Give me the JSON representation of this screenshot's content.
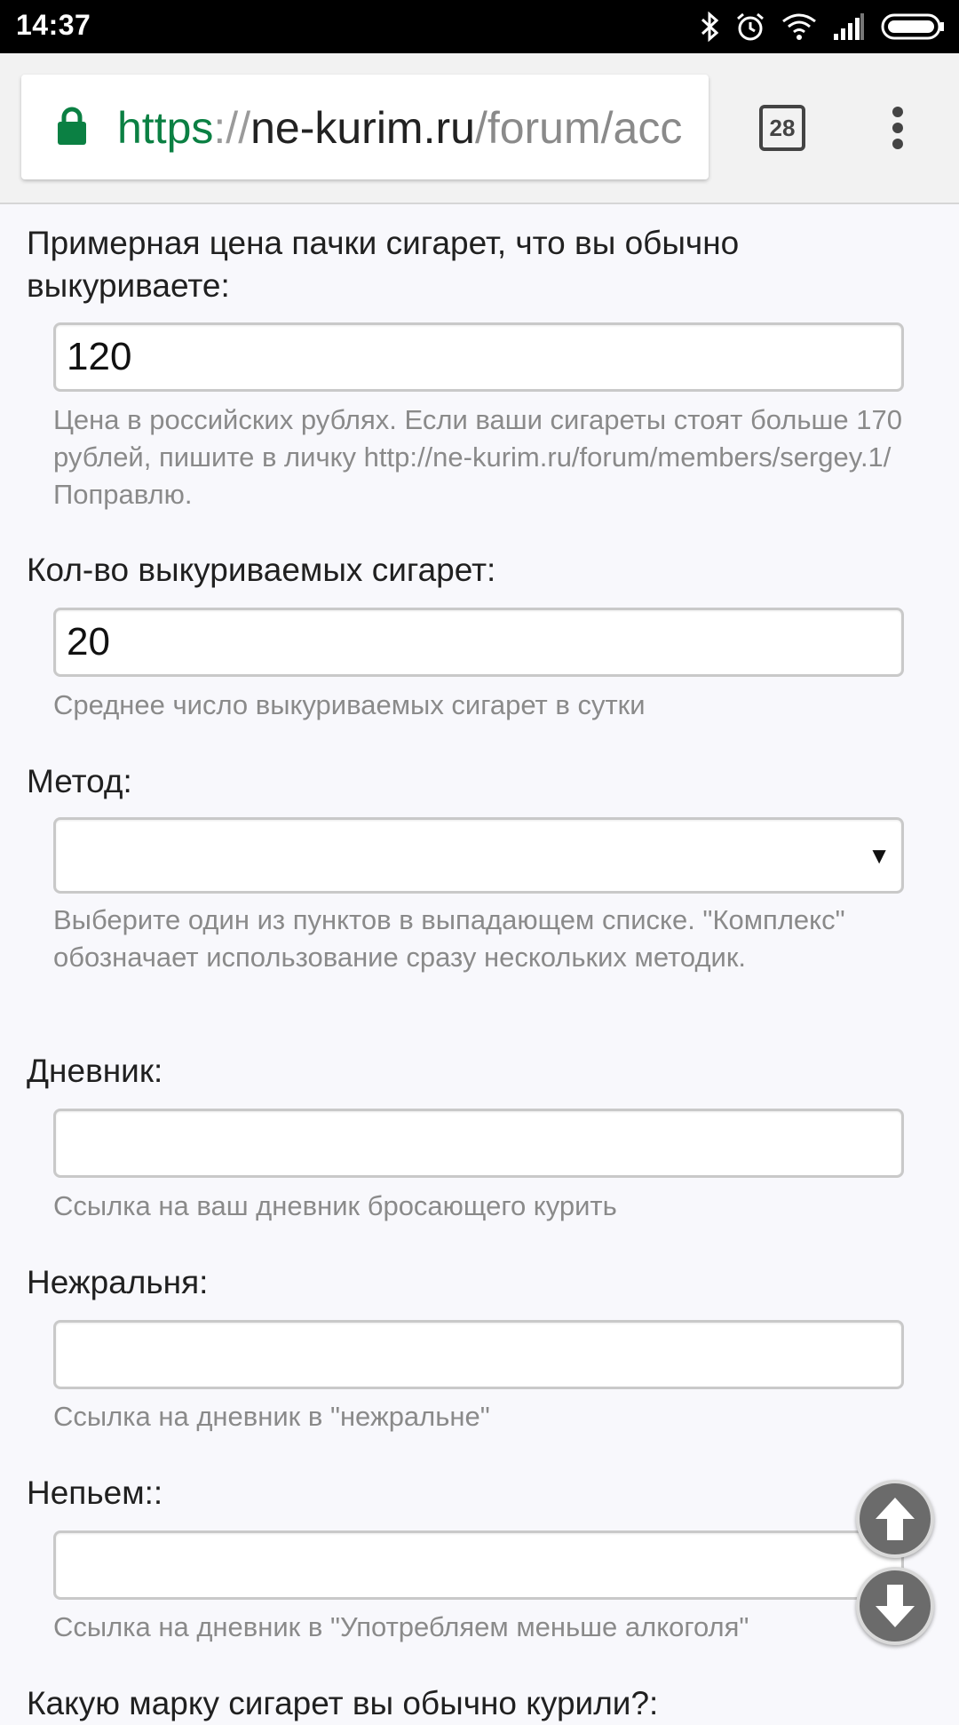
{
  "status_bar": {
    "time": "14:37",
    "icons": [
      "bluetooth-icon",
      "alarm-icon",
      "wifi-icon",
      "signal-icon",
      "battery-icon"
    ]
  },
  "browser": {
    "url_scheme": "https",
    "url_sep": "://",
    "url_host": "ne-kurim.ru",
    "url_path": "/forum/acc",
    "tab_count": "28",
    "colors": {
      "scheme": "#0b8043"
    }
  },
  "form": {
    "price": {
      "label": "Примерная цена пачки сигарет, что вы обычно выкуриваете:",
      "value": "120",
      "hint": "Цена в российских рублях. Если ваши сигареты стоят больше 170 рублей, пишите в личку http://ne-kurim.ru/forum/members/sergey.1/ Поправлю."
    },
    "count": {
      "label": "Кол-во выкуриваемых сигарет:",
      "value": "20",
      "hint": "Среднее число выкуриваемых сигарет в сутки"
    },
    "method": {
      "label": "Метод:",
      "value": "",
      "arrow": "▼",
      "hint": "Выберите один из пунктов в выпадающем списке. \"Комплекс\" обозначает использование сразу нескольких методик."
    },
    "diary": {
      "label": "Дневник:",
      "value": "",
      "hint": "Ссылка на ваш дневник бросающего курить"
    },
    "nezhralnya": {
      "label": "Нежральня:",
      "value": "",
      "hint": "Ссылка на дневник в \"нежральне\""
    },
    "nepyem": {
      "label": "Непьем::",
      "value": "",
      "hint": "Ссылка на дневник в \"Употребляем меньше алкоголя\""
    },
    "brand": {
      "label": "Какую марку сигарет вы обычно курили?:"
    }
  }
}
